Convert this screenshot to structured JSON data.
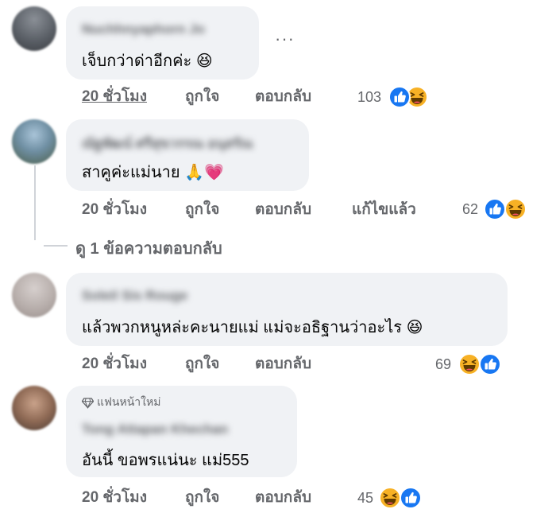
{
  "comments": [
    {
      "author": "Nuchhnyaphorn Jo",
      "text": "เจ็บกว่าด่าอีกค่ะ",
      "emoji": "😆",
      "time": "20 ชั่วโมง",
      "like_label": "ถูกใจ",
      "reply_label": "ตอบกลับ",
      "count": "103",
      "more_label": "···"
    },
    {
      "author": "ณัฐพัฒน์ ศรีสุขวรรณ อนุสรัณ",
      "text": "สาคูค่ะแม่นาย",
      "emoji": "🙏💗",
      "time": "20 ชั่วโมง",
      "like_label": "ถูกใจ",
      "reply_label": "ตอบกลับ",
      "edited_label": "แก้ไขแล้ว",
      "count": "62"
    },
    {
      "author": "Soleil Sis Rouge",
      "text": "แล้วพวกหนูหล่ะคะนายแม่ แม่จะอธิฐานว่าอะไร",
      "emoji": "😆",
      "time": "20 ชั่วโมง",
      "like_label": "ถูกใจ",
      "reply_label": "ตอบกลับ",
      "count": "69"
    },
    {
      "badge": "แฟนหน้าใหม่",
      "author": "Tong Attapan Khechan",
      "text": "อันนี้ ขอพรแน่นะ แม่555",
      "time": "20 ชั่วโมง",
      "like_label": "ถูกใจ",
      "reply_label": "ตอบกลับ",
      "count": "45"
    }
  ],
  "view_replies": "ดู 1 ข้อความตอบกลับ",
  "colors": {
    "like_blue": "#1877f2",
    "haha_yellow": "#f7b125",
    "bubble_gray": "#f0f2f5",
    "meta_gray": "#65676b"
  },
  "icons": [
    "like-reaction-icon",
    "haha-reaction-icon",
    "diamond-badge-icon",
    "more-options-icon"
  ]
}
